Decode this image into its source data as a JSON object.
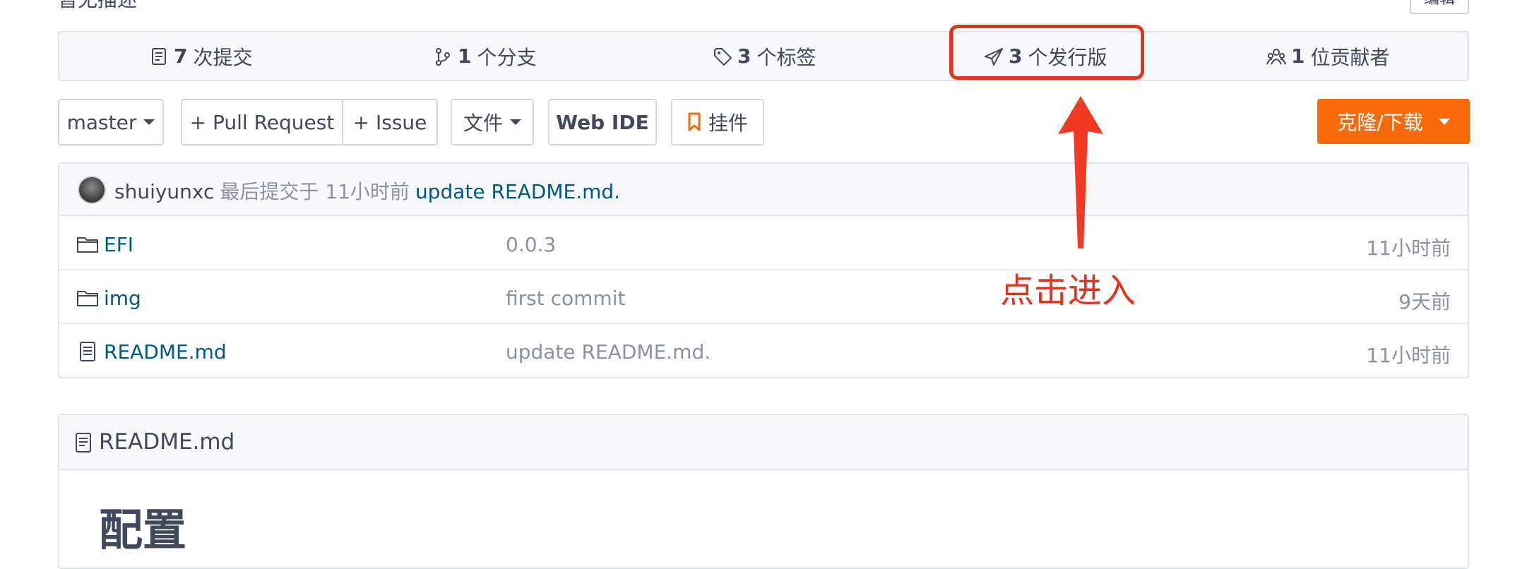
{
  "repo": {
    "description_label": "暂无描述",
    "edit_label": "编辑"
  },
  "stats": {
    "commits": {
      "count": "7",
      "label": "次提交"
    },
    "branches": {
      "count": "1",
      "label": "个分支"
    },
    "tags": {
      "count": "3",
      "label": "个标签"
    },
    "releases": {
      "count": "3",
      "label": "个发行版"
    },
    "contributors": {
      "count": "1",
      "label": "位贡献者"
    }
  },
  "toolbar": {
    "branch": "master",
    "pull_request": "+ Pull Request",
    "issue": "+ Issue",
    "files": "文件",
    "web_ide": "Web IDE",
    "widget": "挂件",
    "clone": "克隆/下载"
  },
  "last_commit": {
    "author": "shuiyunxc",
    "meta": "最后提交于 11小时前",
    "message": "update README.md."
  },
  "files": [
    {
      "name": "EFI",
      "type": "folder",
      "commit": "0.0.3",
      "time": "11小时前"
    },
    {
      "name": "img",
      "type": "folder",
      "commit": "first commit",
      "time": "9天前"
    },
    {
      "name": "README.md",
      "type": "file",
      "commit": "update README.md.",
      "time": "11小时前"
    }
  ],
  "readme": {
    "filename": "README.md",
    "heading": "配置"
  },
  "annotation": {
    "text": "点击进入",
    "color": "#e5321d"
  },
  "colors": {
    "accent": "#f96a0c",
    "link": "#005980",
    "muted": "#8c92a4"
  }
}
